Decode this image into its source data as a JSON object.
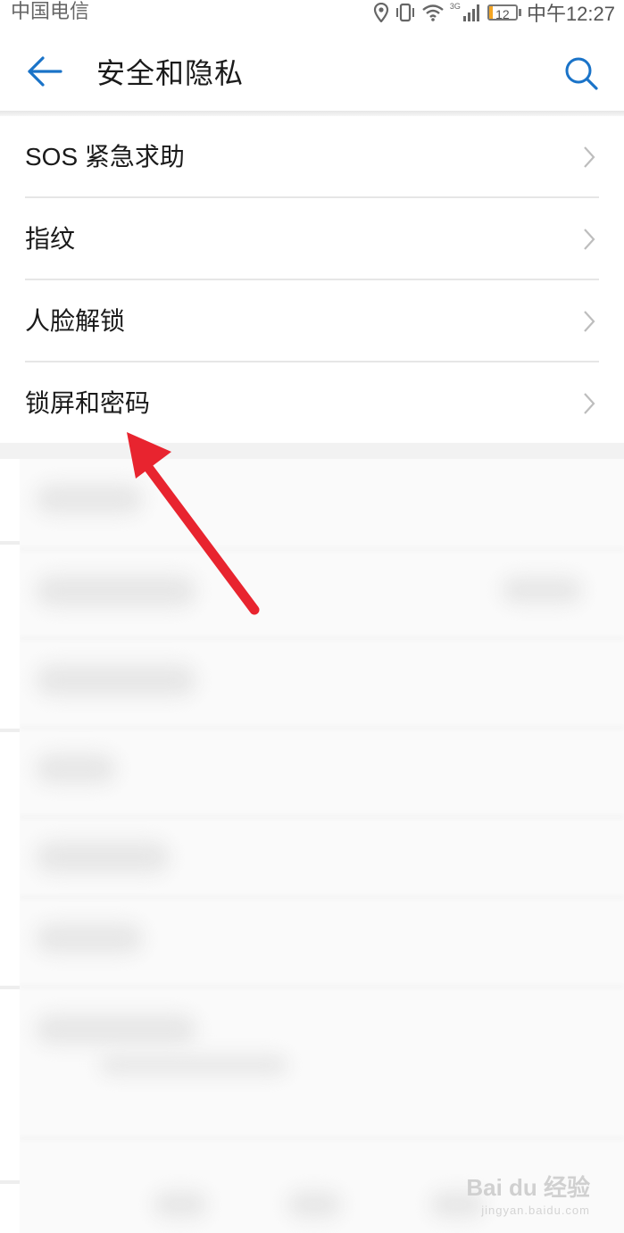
{
  "status_bar": {
    "carrier": "中国电信",
    "network": "3G",
    "battery": "12",
    "battery_level": 0.12,
    "time": "中午12:27"
  },
  "app_bar": {
    "title": "安全和隐私",
    "back_icon": "arrow-left-icon",
    "search_icon": "search-icon"
  },
  "colors": {
    "accent": "#1a73c8",
    "annotation_arrow": "#e8242f"
  },
  "menu_items": [
    {
      "label": "SOS 紧急求助"
    },
    {
      "label": "指纹"
    },
    {
      "label": "人脸解锁"
    },
    {
      "label": "锁屏和密码"
    }
  ],
  "watermark": {
    "text": "Bai du 经验",
    "sub": "jingyan.baidu.com"
  }
}
